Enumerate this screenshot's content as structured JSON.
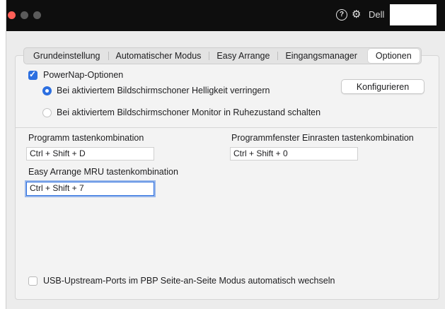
{
  "titlebar": {
    "brand": "Dell",
    "help_icon_text": "?",
    "settings_icon_text": "⚙"
  },
  "tabs": [
    {
      "label": "Grundeinstellung"
    },
    {
      "label": "Automatischer Modus"
    },
    {
      "label": "Easy Arrange"
    },
    {
      "label": "Eingangsmanager"
    },
    {
      "label": "Optionen",
      "active": true
    }
  ],
  "powernap": {
    "checkbox_label": "PowerNap-Optionen",
    "checked": true,
    "option_dim_label": "Bei aktiviertem Bildschirmschoner Helligkeit verringern",
    "option_sleep_label": "Bei aktiviertem Bildschirmschoner Monitor in Ruhezustand schalten",
    "selected": "option_dim",
    "configure_button": "Konfigurieren"
  },
  "shortcuts": {
    "program_label": "Programm tastenkombination",
    "program_value": "Ctrl + Shift + D",
    "snap_label": "Programmfenster Einrasten tastenkombination",
    "snap_value": "Ctrl + Shift + 0",
    "mru_label": "Easy Arrange MRU tastenkombination",
    "mru_value": "Ctrl + Shift + 7"
  },
  "usb": {
    "label": "USB-Upstream-Ports im PBP Seite-an-Seite Modus automatisch wechseln",
    "checked": false
  },
  "colors": {
    "accent": "#2c6fe0",
    "titlebar": "#0e0e0e",
    "close_light": "#ff5f57"
  }
}
